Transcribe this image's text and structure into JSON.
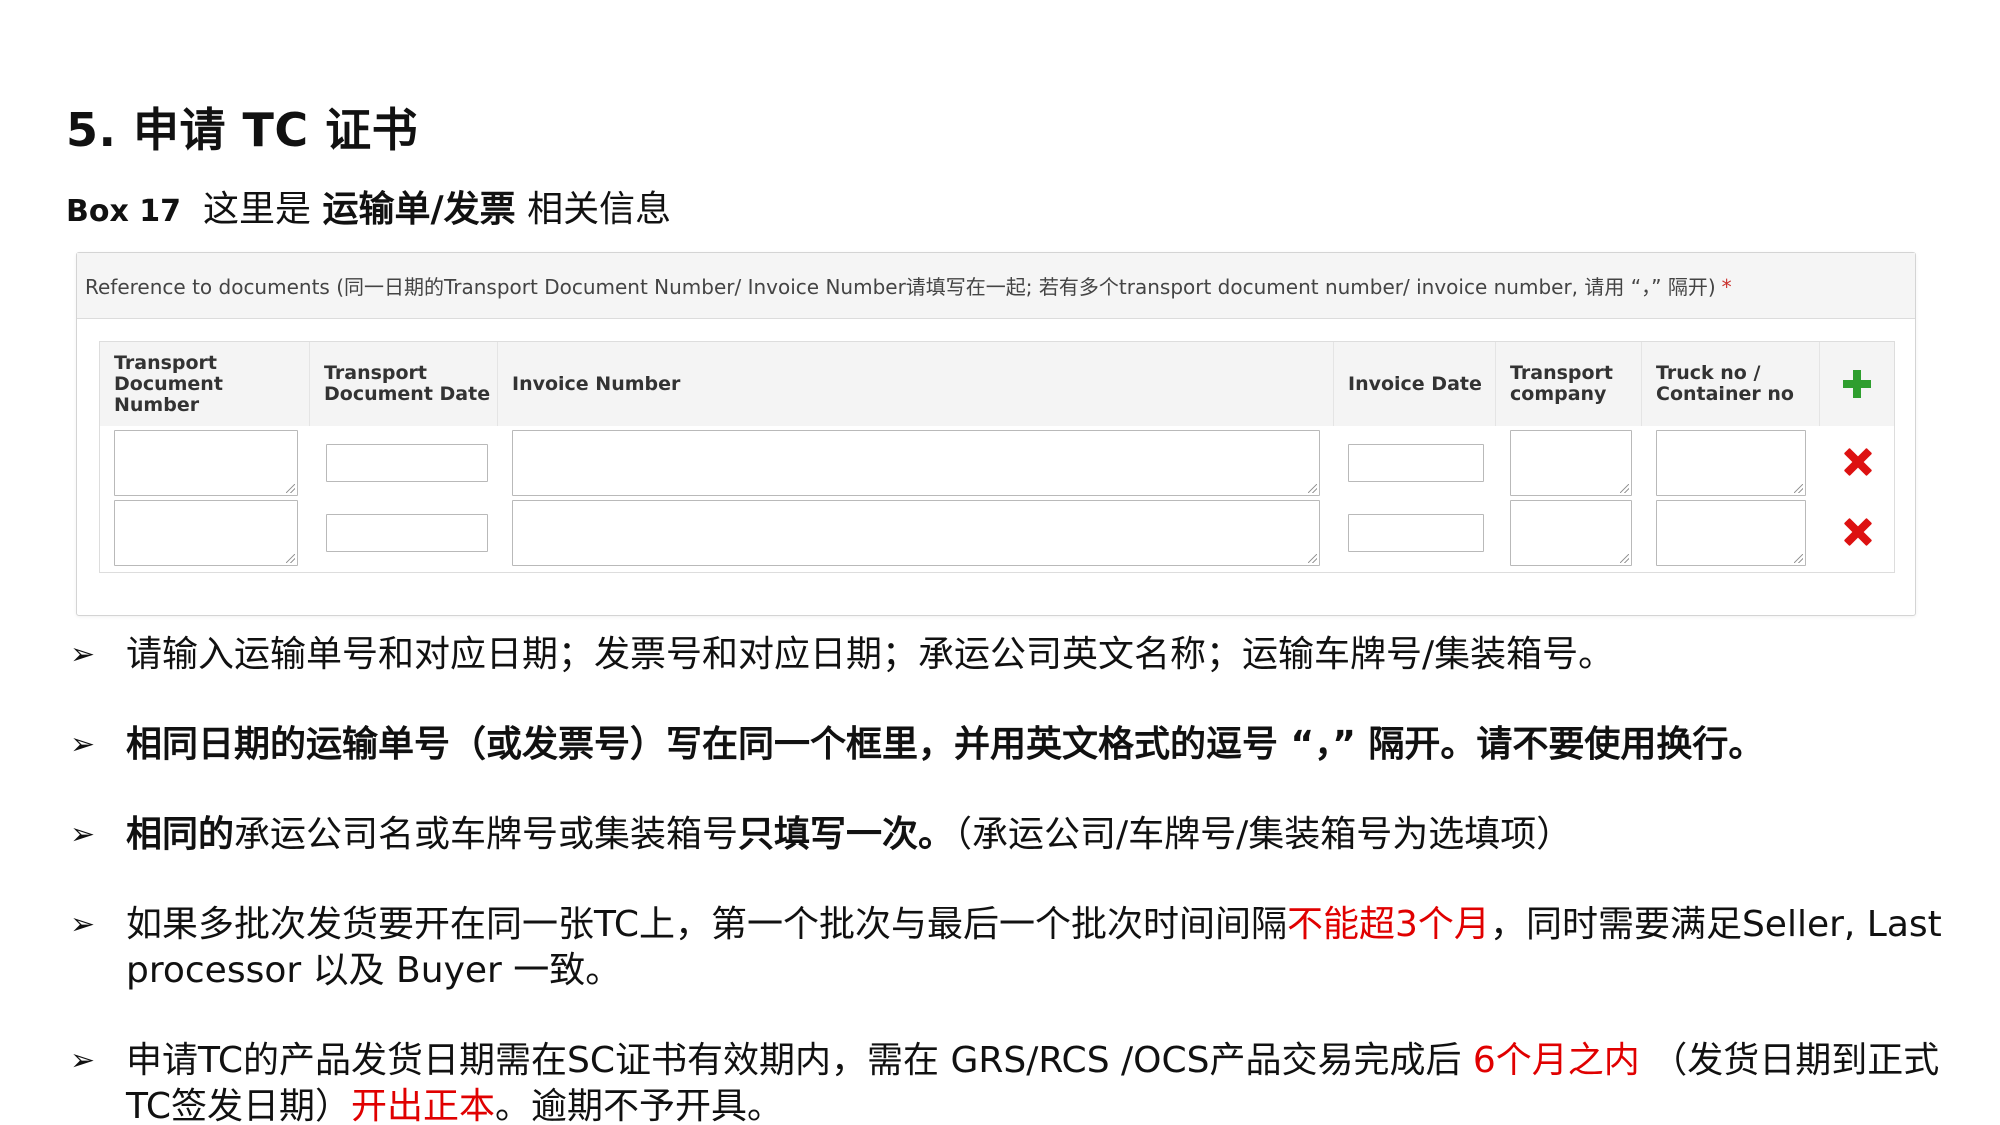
{
  "heading": {
    "number": "5.",
    "text": "申请 TC 证书"
  },
  "subheading": {
    "box": "Box 17",
    "prefix": "这里是 ",
    "bold": "运输单/发票",
    "suffix": " 相关信息"
  },
  "form": {
    "label": "Reference to documents (同一日期的Transport Document Number/ Invoice Number请填写在一起; 若有多个transport document number/ invoice number, 请用 “，” 隔开)",
    "required_mark": "*",
    "columns": [
      "Transport Document Number",
      "Transport Document Date",
      "Invoice Number",
      "Invoice Date",
      "Transport company",
      "Truck no / Container no"
    ],
    "rows": [
      {
        "transport_doc_number": "",
        "transport_doc_date": "",
        "invoice_number": "",
        "invoice_date": "",
        "transport_company": "",
        "truck_container_no": ""
      },
      {
        "transport_doc_number": "",
        "transport_doc_date": "",
        "invoice_number": "",
        "invoice_date": "",
        "transport_company": "",
        "truck_container_no": ""
      }
    ],
    "icons": {
      "add": "plus-icon",
      "remove": "close-icon"
    },
    "colors": {
      "add": "#2e9e2e",
      "remove": "#dd1111",
      "highlight": "#e00000"
    }
  },
  "bullets": {
    "arrow": "➢",
    "b1": "请输入运输单号和对应日期；发票号和对应日期；承运公司英文名称；运输车牌号/集装箱号。",
    "b2": "相同日期的运输单号（或发票号）写在同一个框里，并用英文格式的逗号 “，” 隔开。请不要使用换行。",
    "b3a": "相同的",
    "b3b": "承运公司名或车牌号或集装箱号",
    "b3c": "只填写一次。",
    "b3d": "（承运公司/车牌号/集装箱号为选填项）",
    "b4a": "如果多批次发货要开在同一张TC上，第一个批次与最后一个批次时间间隔",
    "b4b": "不能超3个月",
    "b4c": "，同时需要满足Seller, Last processor 以及 Buyer 一致。",
    "b5a": "申请TC的产品发货日期需在SC证书有效期内，需在 GRS/RCS /OCS产品交易完成后 ",
    "b5b": "6个月之内",
    "b5c": " （发货日期到正式TC签发日期）",
    "b5d": "开出正本",
    "b5e": "。逾期不予开具。"
  }
}
